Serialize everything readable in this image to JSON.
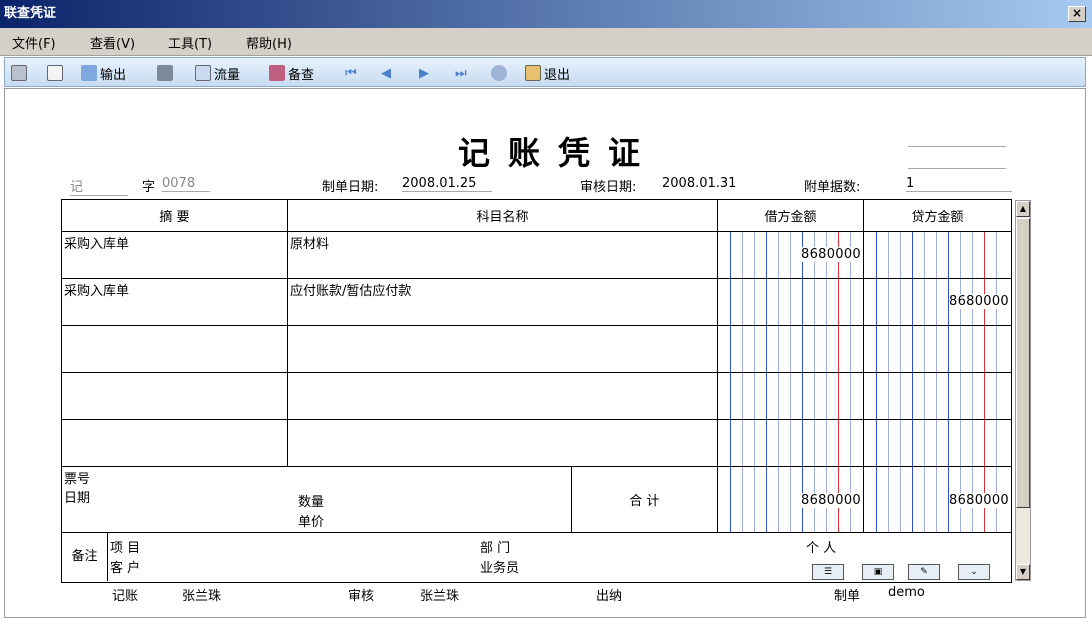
{
  "window": {
    "title": "联查凭证",
    "close": "×"
  },
  "menu": [
    "文件(F)",
    "查看(V)",
    "工具(T)",
    "帮助(H)"
  ],
  "toolbar": {
    "output": "输出",
    "flow": "流量",
    "check": "备查",
    "exit": "退出"
  },
  "voucher": {
    "title": "记账凭证",
    "type_label": "记",
    "word_label": "字",
    "number": "0078",
    "make_date_label": "制单日期:",
    "make_date": "2008.01.25",
    "audit_date_label": "审核日期:",
    "audit_date": "2008.01.31",
    "attach_label": "附单据数:",
    "attach": "1",
    "headers": {
      "summary": "摘 要",
      "account": "科目名称",
      "debit": "借方金额",
      "credit": "贷方金额"
    },
    "rows": [
      {
        "summary": "采购入库单",
        "account": "原材料",
        "debit": "8680000",
        "credit": ""
      },
      {
        "summary": "采购入库单",
        "account": "应付账款/暂估应付款",
        "debit": "",
        "credit": "8680000"
      },
      {
        "summary": "",
        "account": "",
        "debit": "",
        "credit": ""
      },
      {
        "summary": "",
        "account": "",
        "debit": "",
        "credit": ""
      },
      {
        "summary": "",
        "account": "",
        "debit": "",
        "credit": ""
      }
    ],
    "totals": {
      "ticket_label": "票号",
      "date_label": "日期",
      "qty_label": "数量",
      "price_label": "单价",
      "total_label": "合 计",
      "debit": "8680000",
      "credit": "8680000"
    },
    "notes": {
      "label": "备注",
      "project": "项 目",
      "customer": "客 户",
      "dept": "部 门",
      "salesman": "业务员",
      "person": "个 人"
    },
    "footer": {
      "bookkeeper_label": "记账",
      "bookkeeper": "张兰珠",
      "auditor_label": "审核",
      "auditor": "张兰珠",
      "cashier_label": "出纳",
      "maker_label": "制单",
      "maker": "demo"
    }
  }
}
